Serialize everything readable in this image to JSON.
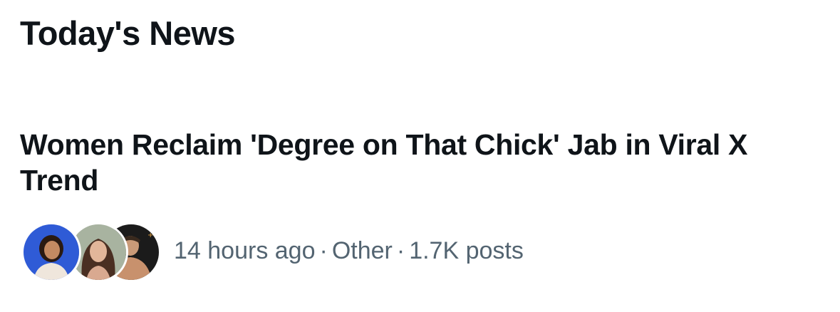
{
  "section": {
    "title": "Today's News"
  },
  "news_item": {
    "headline": "Women Reclaim 'Degree on That Chick' Jab in Viral X Trend",
    "time_ago": "14 hours ago",
    "separator": "·",
    "category": "Other",
    "post_count": "1.7K posts",
    "avatars": [
      "person-avatar-woman-blue",
      "person-avatar-woman-long-hair",
      "person-avatar-man-dark-background"
    ]
  },
  "colors": {
    "text_primary": "#0f1419",
    "text_secondary": "#536471",
    "avatar1_bg": "#2f5bd6",
    "avatar2_bg": "#a8b3a0",
    "avatar3_bg": "#1b1b1b"
  }
}
